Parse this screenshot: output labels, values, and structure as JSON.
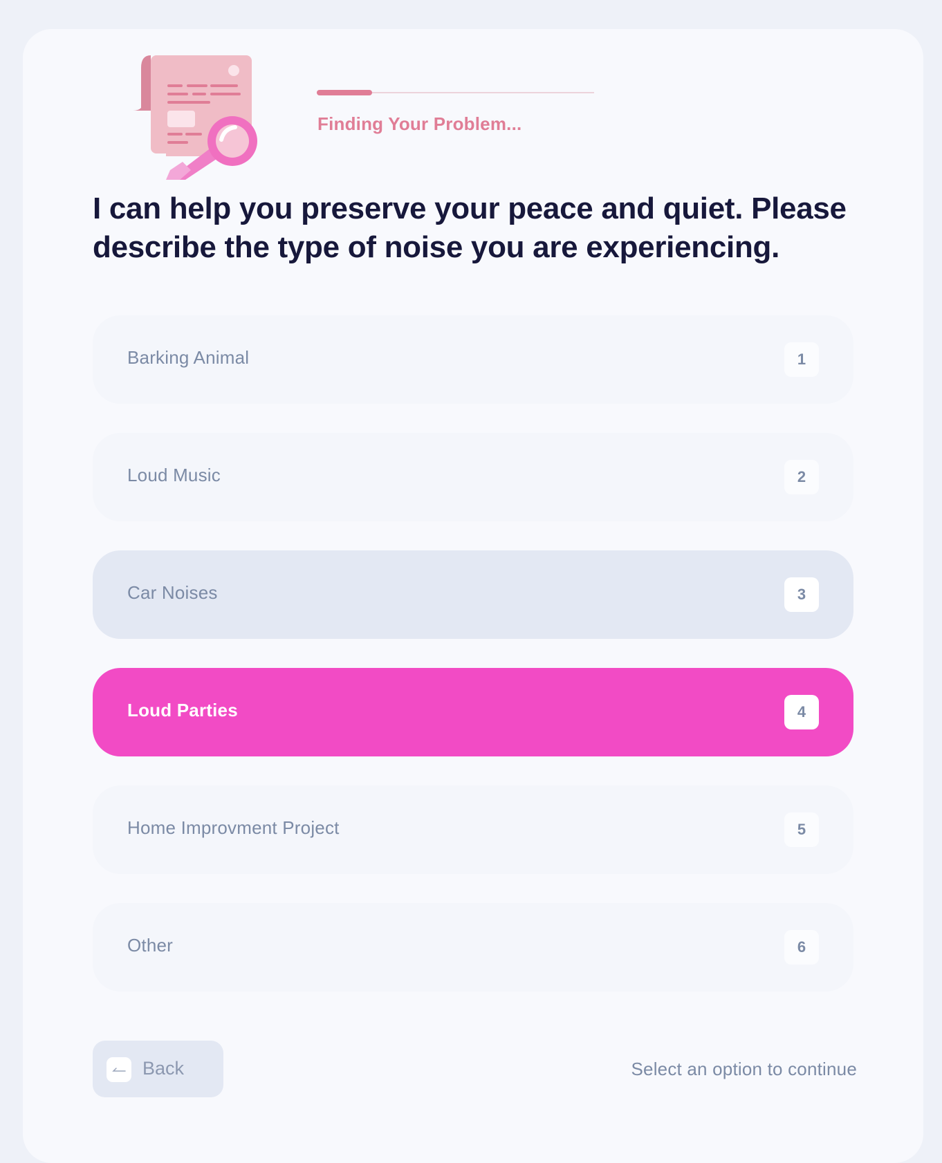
{
  "progress": {
    "label": "Finding Your Problem...",
    "fraction": 0.2,
    "fill_color": "#e07d96"
  },
  "question": "I can help you preserve your peace and quiet. Please describe the type of noise you are experiencing.",
  "options": [
    {
      "label": "Barking Animal",
      "key": "1",
      "state": "default"
    },
    {
      "label": "Loud Music",
      "key": "2",
      "state": "default"
    },
    {
      "label": "Car Noises",
      "key": "3",
      "state": "hover"
    },
    {
      "label": "Loud Parties",
      "key": "4",
      "state": "selected"
    },
    {
      "label": "Home Improvment Project",
      "key": "5",
      "state": "default"
    },
    {
      "label": "Other",
      "key": "6",
      "state": "default"
    }
  ],
  "back_button": {
    "label": "Back",
    "icon": "arrow-left-icon"
  },
  "hint": "Select an option to continue",
  "colors": {
    "accent": "#f24bc5",
    "progress_text": "#e07d96",
    "heading": "#17183b"
  },
  "illustration_icon": "document-magnifier-icon"
}
